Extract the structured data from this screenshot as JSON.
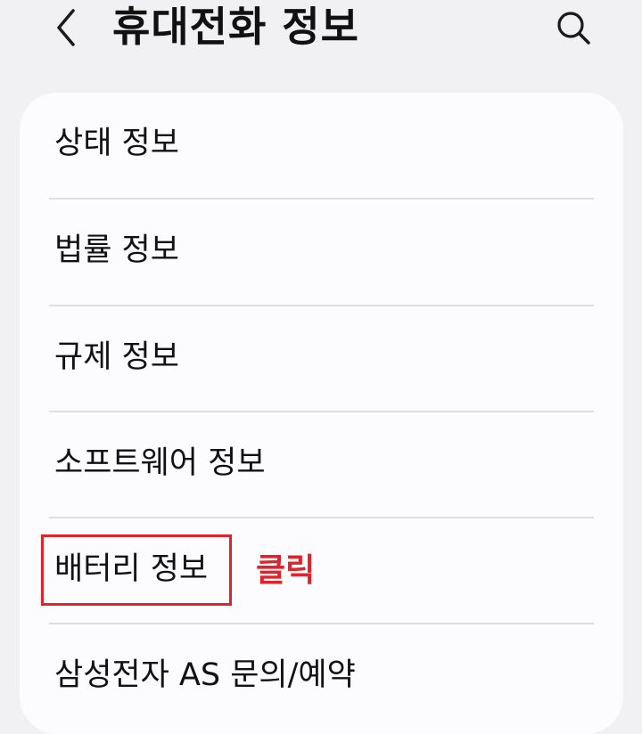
{
  "header": {
    "title": "휴대전화 정보",
    "back_icon": "chevron-left-icon",
    "search_icon": "search-icon"
  },
  "menu": {
    "items": [
      {
        "label": "상태 정보"
      },
      {
        "label": "법률 정보"
      },
      {
        "label": "규제 정보"
      },
      {
        "label": "소프트웨어 정보"
      },
      {
        "label": "배터리 정보"
      },
      {
        "label": "삼성전자 AS 문의/예약"
      }
    ]
  },
  "annotation": {
    "click_label": "클릭",
    "highlight_color": "#e0242c"
  }
}
